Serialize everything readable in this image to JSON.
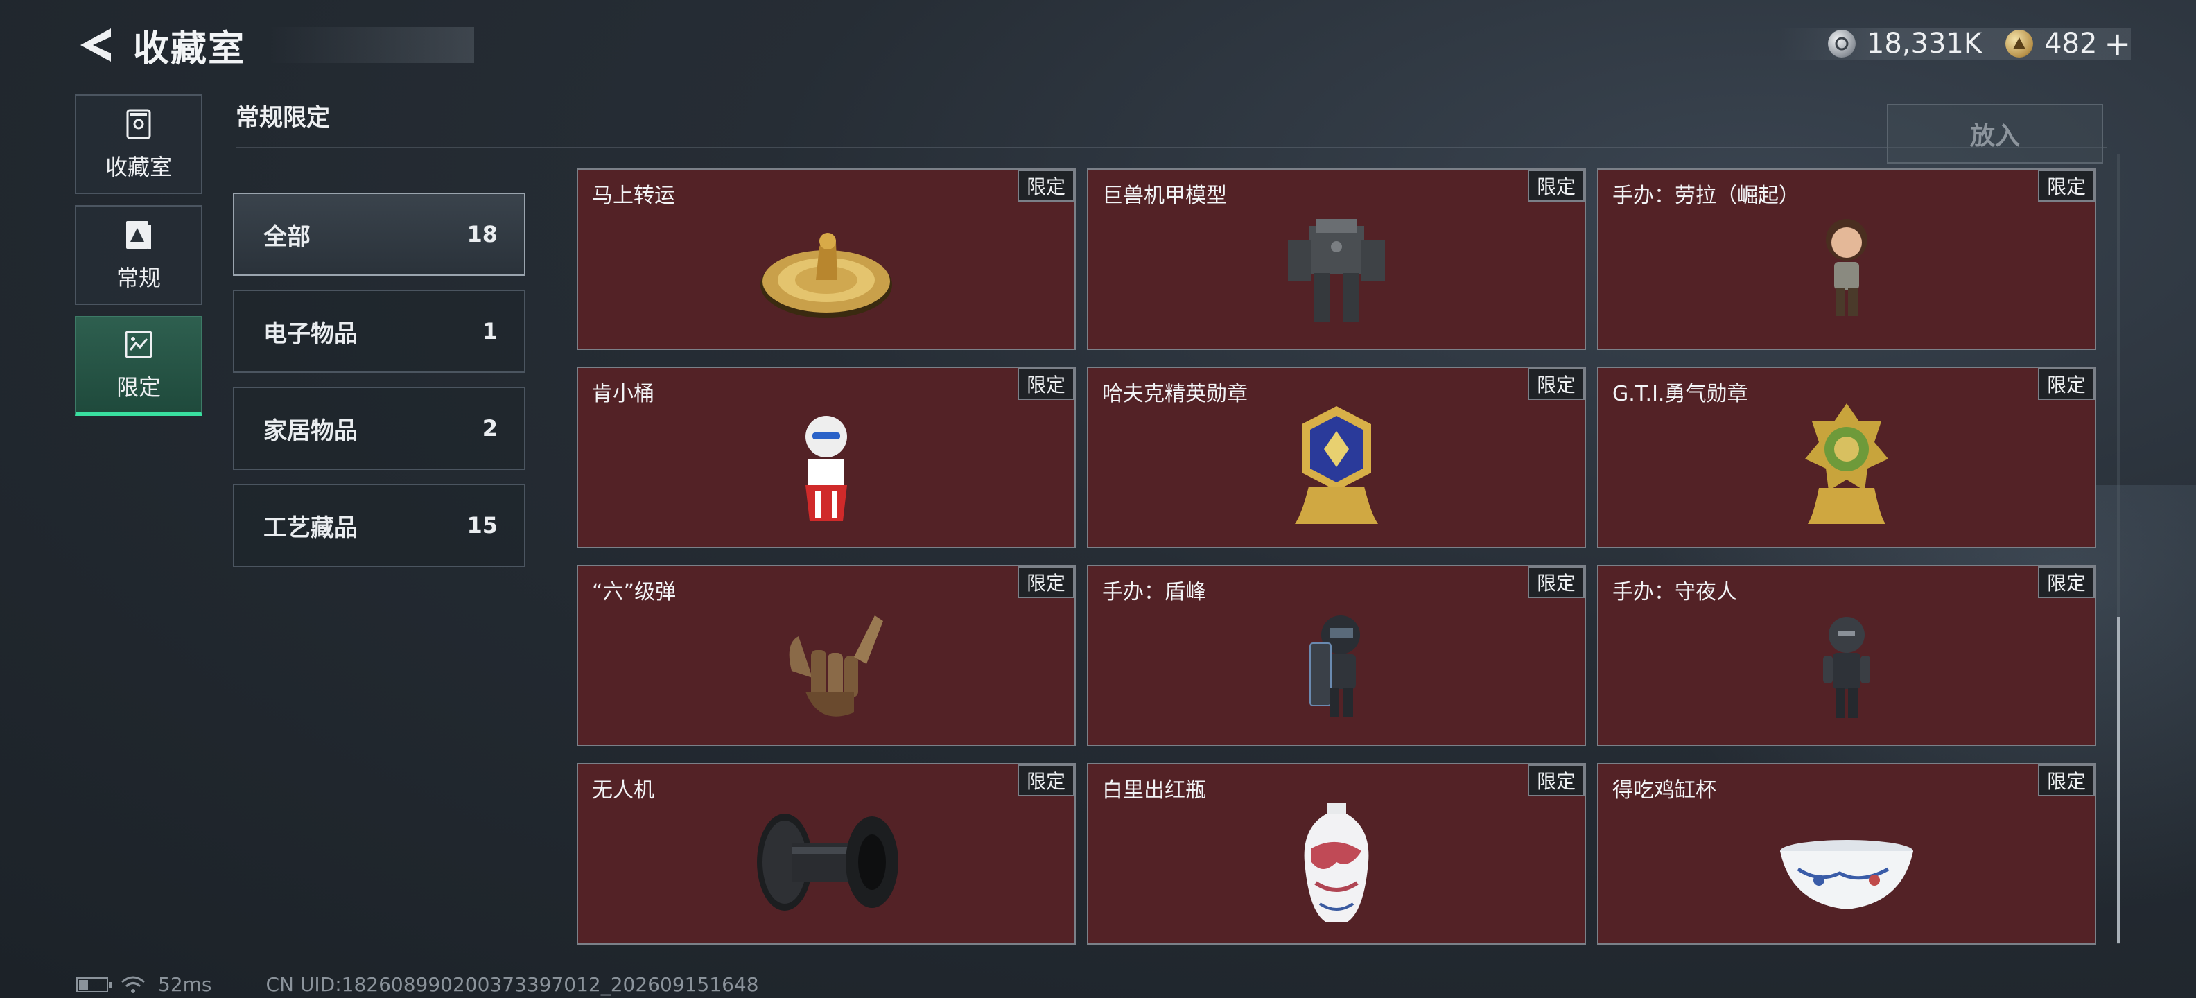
{
  "header": {
    "title": "收藏室",
    "back_icon": "back-arrow-icon"
  },
  "currency": [
    {
      "icon": "silver-coin-icon",
      "value": "18,331K"
    },
    {
      "icon": "gold-coin-icon",
      "value": "482"
    }
  ],
  "currency_add_label": "+",
  "left_nav": [
    {
      "label": "收藏室",
      "icon": "collection-room-icon",
      "active": false
    },
    {
      "label": "常规",
      "icon": "regular-icon",
      "active": false
    },
    {
      "label": "限定",
      "icon": "limited-icon",
      "active": true
    }
  ],
  "section": {
    "title": "常规限定",
    "put_button": "放入"
  },
  "categories": [
    {
      "label": "全部",
      "count": "18",
      "active": true
    },
    {
      "label": "电子物品",
      "count": "1",
      "active": false
    },
    {
      "label": "家居物品",
      "count": "2",
      "active": false
    },
    {
      "label": "工艺藏品",
      "count": "15",
      "active": false
    }
  ],
  "items": [
    {
      "name": "马上转运",
      "badge": "限定",
      "icon": "golden-horse-compass-icon"
    },
    {
      "name": "巨兽机甲模型",
      "badge": "限定",
      "icon": "mech-model-icon"
    },
    {
      "name": "手办：劳拉（崛起）",
      "badge": "限定",
      "icon": "lara-figure-icon"
    },
    {
      "name": "肯小桶",
      "badge": "限定",
      "icon": "kfc-bucket-figure-icon"
    },
    {
      "name": "哈夫克精英勋章",
      "badge": "限定",
      "icon": "haavk-elite-medal-icon"
    },
    {
      "name": "G.T.I.勇气勋章",
      "badge": "限定",
      "icon": "gti-courage-medal-icon"
    },
    {
      "name": "“六”级弹",
      "badge": "限定",
      "icon": "six-bullet-hand-icon"
    },
    {
      "name": "手办：盾峰",
      "badge": "限定",
      "icon": "shield-figure-icon"
    },
    {
      "name": "手办：守夜人",
      "badge": "限定",
      "icon": "nightwatch-figure-icon"
    },
    {
      "name": "无人机",
      "badge": "限定",
      "icon": "drone-icon"
    },
    {
      "name": "白里出红瓶",
      "badge": "限定",
      "icon": "porcelain-vase-icon"
    },
    {
      "name": "得吃鸡缸杯",
      "badge": "限定",
      "icon": "chicken-cup-icon"
    }
  ],
  "scroll_progress": 0.58,
  "status": {
    "ping": "52ms",
    "uid": "CN UID:182608990200373397012_202609151648",
    "battery_level": 0.3
  }
}
